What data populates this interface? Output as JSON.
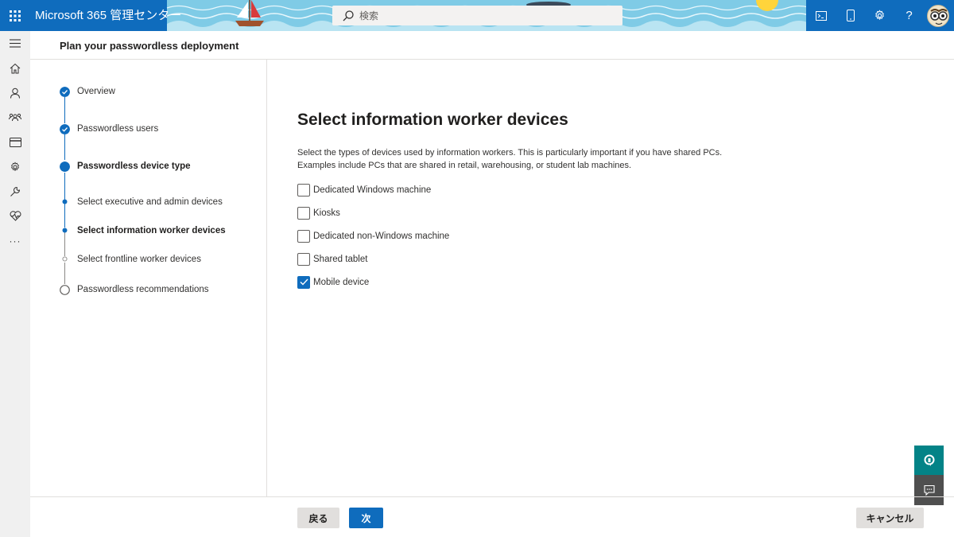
{
  "topbar": {
    "app_title": "Microsoft 365 管理センター",
    "search_placeholder": "検索",
    "icons": [
      "waffle-icon",
      "terminal-icon",
      "mobile-icon",
      "gear-icon",
      "help-icon",
      "avatar"
    ],
    "help_label": "?"
  },
  "rail": {
    "items": [
      "menu-icon",
      "home-icon",
      "user-icon",
      "groups-icon",
      "billing-icon",
      "settings-icon",
      "setup-icon",
      "health-icon",
      "more-icon"
    ],
    "more_label": "···"
  },
  "header": {
    "title": "Plan your passwordless deployment"
  },
  "stepper": {
    "steps": [
      {
        "label": "Overview",
        "state": "done"
      },
      {
        "label": "Passwordless users",
        "state": "done"
      },
      {
        "label": "Passwordless device type",
        "state": "current"
      },
      {
        "label": "Select executive and admin devices",
        "state": "sub-done"
      },
      {
        "label": "Select information worker devices",
        "state": "sub-current"
      },
      {
        "label": "Select frontline worker devices",
        "state": "sub-todo"
      },
      {
        "label": "Passwordless recommendations",
        "state": "todo"
      }
    ]
  },
  "main": {
    "title": "Select information worker devices",
    "description_line1": "Select the types of devices used by information workers. This is particularly important if you have shared PCs.",
    "description_line2": "Examples include PCs that are shared in retail, warehousing, or student lab machines.",
    "options": [
      {
        "label": "Dedicated Windows machine",
        "checked": false
      },
      {
        "label": "Kiosks",
        "checked": false
      },
      {
        "label": "Dedicated non-Windows machine",
        "checked": false
      },
      {
        "label": "Shared tablet",
        "checked": false
      },
      {
        "label": "Mobile device",
        "checked": true
      }
    ]
  },
  "footer": {
    "back_label": "戻る",
    "next_label": "次",
    "cancel_label": "キャンセル"
  },
  "colors": {
    "accent": "#0f6cbd",
    "topbar": "#0f6cbd",
    "help_button": "#038387",
    "feedback_button": "#4f4f4f"
  }
}
